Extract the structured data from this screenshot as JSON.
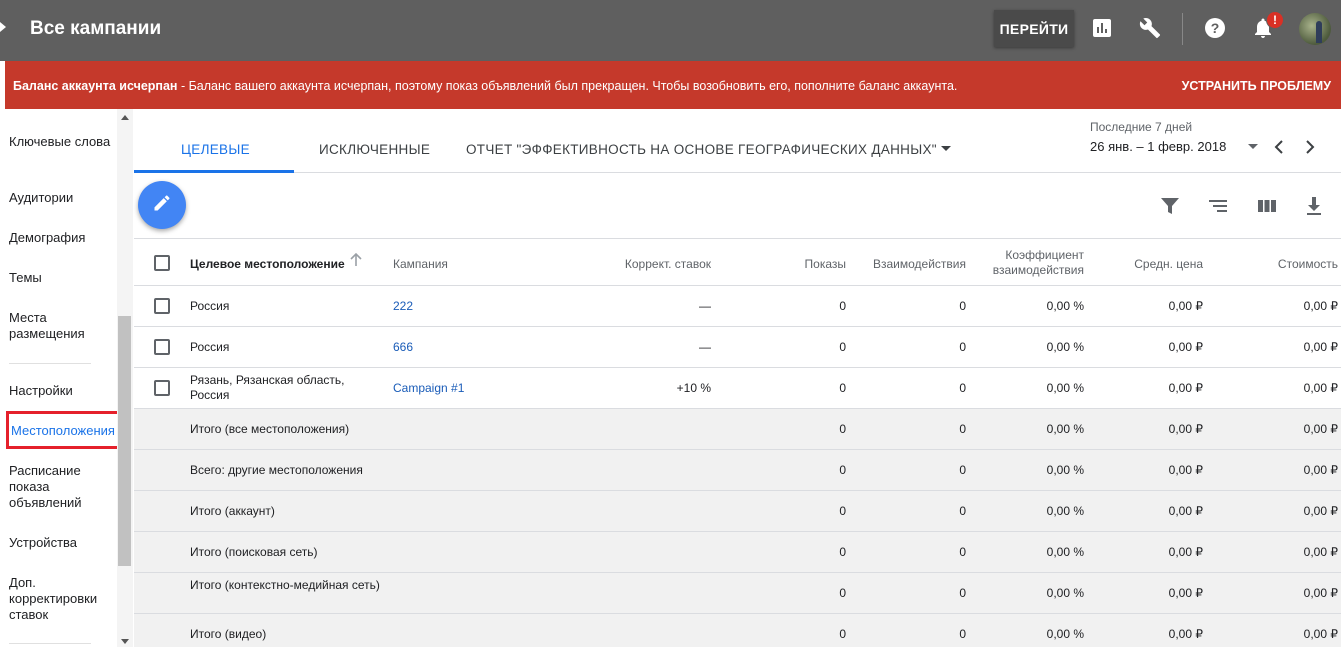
{
  "header": {
    "title": "Все кампании",
    "go_button": "ПЕРЕЙТИ",
    "notification_badge": "!"
  },
  "alert": {
    "bold": "Баланс аккаунта исчерпан",
    "text": " - Баланс вашего аккаунта исчерпан, поэтому показ объявлений был прекращен. Чтобы возобновить его, пополните баланс аккаунта.",
    "action": "УСТРАНИТЬ ПРОБЛЕМУ",
    "color": "#c5392b"
  },
  "sidebar": {
    "items": [
      {
        "label": "Ключевые слова"
      },
      {
        "label": "Аудитории"
      },
      {
        "label": "Демография"
      },
      {
        "label": "Темы"
      },
      {
        "label": "Места размещения"
      },
      {
        "label": "Настройки"
      },
      {
        "label": "Местоположения"
      },
      {
        "label": "Расписание показа объявлений"
      },
      {
        "label": "Устройства"
      },
      {
        "label": "Доп. корректировки ставок"
      }
    ]
  },
  "tabs": {
    "items": [
      {
        "label": "ЦЕЛЕВЫЕ"
      },
      {
        "label": "ИСКЛЮЧЕННЫЕ"
      },
      {
        "label": "ОТЧЕТ \"ЭФФЕКТИВНОСТЬ НА ОСНОВЕ ГЕОГРАФИЧЕСКИХ ДАННЫХ\""
      }
    ],
    "date_label": "Последние 7 дней",
    "date_range": "26 янв. – 1 февр. 2018"
  },
  "table": {
    "columns": {
      "location": "Целевое местоположение",
      "campaign": "Кампания",
      "bid_adj": "Коррект. ставок",
      "impressions": "Показы",
      "interactions": "Взаимодействия",
      "interaction_rate": "Коэффициент взаимодействия",
      "avg_cost": "Средн. цена",
      "cost": "Стоимость"
    },
    "rows": [
      {
        "location": "Россия",
        "campaign": "222",
        "bid_adj": "—",
        "impressions": "0",
        "interactions": "0",
        "interaction_rate": "0,00 %",
        "avg_cost": "0,00 ₽",
        "cost": "0,00 ₽"
      },
      {
        "location": "Россия",
        "campaign": "666",
        "bid_adj": "—",
        "impressions": "0",
        "interactions": "0",
        "interaction_rate": "0,00 %",
        "avg_cost": "0,00 ₽",
        "cost": "0,00 ₽"
      },
      {
        "location": "Рязань, Рязанская область, Россия",
        "campaign": "Campaign #1",
        "bid_adj": "+10 %",
        "impressions": "0",
        "interactions": "0",
        "interaction_rate": "0,00 %",
        "avg_cost": "0,00 ₽",
        "cost": "0,00 ₽"
      }
    ],
    "totals": [
      {
        "label": "Итого (все местоположения)",
        "impressions": "0",
        "interactions": "0",
        "interaction_rate": "0,00 %",
        "avg_cost": "0,00 ₽",
        "cost": "0,00 ₽"
      },
      {
        "label": "Всего: другие местоположения",
        "impressions": "0",
        "interactions": "0",
        "interaction_rate": "0,00 %",
        "avg_cost": "0,00 ₽",
        "cost": "0,00 ₽"
      },
      {
        "label": "Итого (аккаунт)",
        "impressions": "0",
        "interactions": "0",
        "interaction_rate": "0,00 %",
        "avg_cost": "0,00 ₽",
        "cost": "0,00 ₽"
      },
      {
        "label": "Итого (поисковая сеть)",
        "impressions": "0",
        "interactions": "0",
        "interaction_rate": "0,00 %",
        "avg_cost": "0,00 ₽",
        "cost": "0,00 ₽"
      },
      {
        "label": "Итого (контекстно-медийная сеть)",
        "impressions": "0",
        "interactions": "0",
        "interaction_rate": "0,00 %",
        "avg_cost": "0,00 ₽",
        "cost": "0,00 ₽"
      },
      {
        "label": "Итого (видео)",
        "impressions": "0",
        "interactions": "0",
        "interaction_rate": "0,00 %",
        "avg_cost": "0,00 ₽",
        "cost": "0,00 ₽"
      }
    ]
  },
  "icons": {
    "reports": "bar-chart-icon",
    "tools": "wrench-icon",
    "help": "help-icon",
    "notifications": "bell-icon",
    "edit": "pencil-icon",
    "filter": "filter-icon",
    "segment": "segment-icon",
    "columns": "columns-icon",
    "download": "download-icon"
  },
  "colors": {
    "header_bg": "#5f5f5f",
    "accent": "#1a73e8",
    "fab": "#4285f4",
    "highlight": "#e5202b"
  }
}
